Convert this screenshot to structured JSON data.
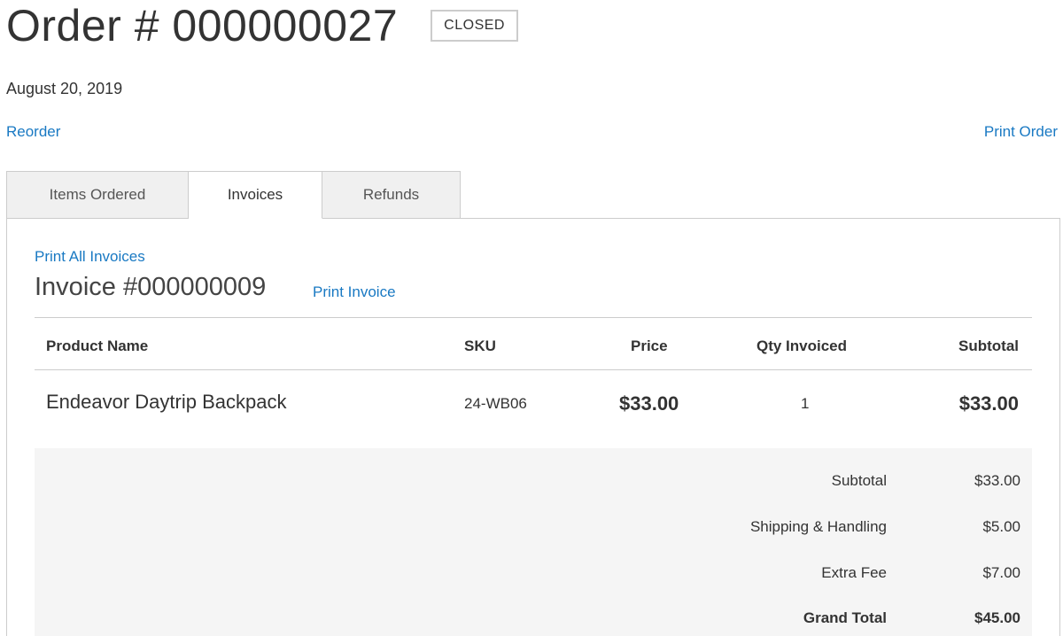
{
  "order": {
    "title": "Order # 000000027",
    "status": "CLOSED",
    "date": "August 20, 2019",
    "reorder_label": "Reorder",
    "print_order_label": "Print Order"
  },
  "tabs": [
    {
      "label": "Items Ordered",
      "active": false
    },
    {
      "label": "Invoices",
      "active": true
    },
    {
      "label": "Refunds",
      "active": false
    }
  ],
  "invoice": {
    "print_all_label": "Print All Invoices",
    "title": "Invoice #000000009",
    "print_invoice_label": "Print Invoice",
    "columns": {
      "product_name": "Product Name",
      "sku": "SKU",
      "price": "Price",
      "qty": "Qty Invoiced",
      "subtotal": "Subtotal"
    },
    "items": [
      {
        "product_name": "Endeavor Daytrip Backpack",
        "sku": "24-WB06",
        "price": "$33.00",
        "qty": "1",
        "subtotal": "$33.00"
      }
    ],
    "totals": [
      {
        "label": "Subtotal",
        "value": "$33.00"
      },
      {
        "label": "Shipping & Handling",
        "value": "$5.00"
      },
      {
        "label": "Extra Fee",
        "value": "$7.00"
      },
      {
        "label": "Grand Total",
        "value": "$45.00"
      }
    ]
  },
  "colors": {
    "link": "#1979c3",
    "text": "#333333",
    "border": "#cccccc",
    "totals_background": "#f5f5f5",
    "inactive_tab": "#f0f0f0"
  }
}
